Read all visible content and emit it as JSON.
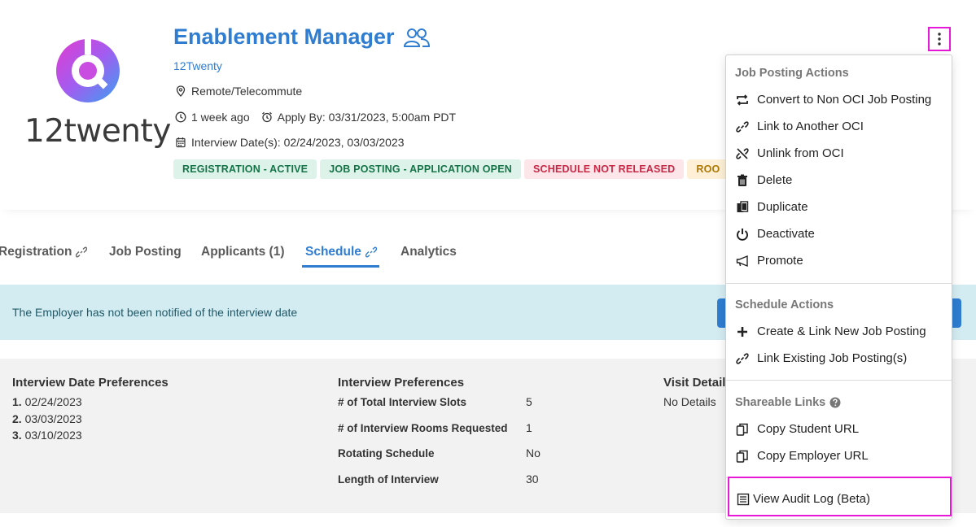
{
  "header": {
    "logo_text": "12twenty",
    "title": "Enablement Manager",
    "company": "12Twenty",
    "location": "Remote/Telecommute",
    "posted": "1 week ago",
    "apply_by": "Apply By: 03/31/2023, 5:00am PDT",
    "interview_dates": "Interview Date(s): 02/24/2023, 03/03/2023",
    "badges": [
      {
        "label": "REGISTRATION - ACTIVE",
        "tone": "green"
      },
      {
        "label": "JOB POSTING - APPLICATION OPEN",
        "tone": "green"
      },
      {
        "label": "SCHEDULE NOT RELEASED",
        "tone": "red"
      },
      {
        "label": "ROO",
        "tone": "yellow"
      }
    ]
  },
  "tabs": [
    {
      "label": "Registration",
      "linked": true,
      "active": false
    },
    {
      "label": "Job Posting",
      "linked": false,
      "active": false
    },
    {
      "label": "Applicants (1)",
      "linked": false,
      "active": false
    },
    {
      "label": "Schedule",
      "linked": true,
      "active": true
    },
    {
      "label": "Analytics",
      "linked": false,
      "active": false
    }
  ],
  "alert": {
    "text": "The Employer has not been notified of the interview date"
  },
  "details": {
    "date_prefs_title": "Interview Date Preferences",
    "date_prefs": [
      {
        "num": "1.",
        "date": "02/24/2023"
      },
      {
        "num": "2.",
        "date": "03/03/2023"
      },
      {
        "num": "3.",
        "date": "03/10/2023"
      }
    ],
    "interview_prefs_title": "Interview Preferences",
    "interview_prefs": [
      {
        "label": "# of Total Interview Slots",
        "value": "5"
      },
      {
        "label": "# of Interview Rooms Requested",
        "value": "1"
      },
      {
        "label": "Rotating Schedule",
        "value": "No"
      },
      {
        "label": "Length of Interview",
        "value": "30"
      }
    ],
    "visit_title": "Visit Detail",
    "visit_value": "No Details"
  },
  "menu": {
    "job_posting_actions": "Job Posting Actions",
    "job_items": [
      {
        "label": "Convert to Non OCI Job Posting",
        "icon": "convert-icon"
      },
      {
        "label": "Link to Another OCI",
        "icon": "link-icon"
      },
      {
        "label": "Unlink from OCI",
        "icon": "unlink-icon"
      },
      {
        "label": "Delete",
        "icon": "trash-icon"
      },
      {
        "label": "Duplicate",
        "icon": "duplicate-icon"
      },
      {
        "label": "Deactivate",
        "icon": "power-icon"
      },
      {
        "label": "Promote",
        "icon": "megaphone-icon"
      }
    ],
    "schedule_actions": "Schedule Actions",
    "schedule_items": [
      {
        "label": "Create & Link New Job Posting",
        "icon": "plus-icon"
      },
      {
        "label": "Link Existing Job Posting(s)",
        "icon": "link-icon"
      }
    ],
    "shareable_links": "Shareable Links",
    "share_items": [
      {
        "label": "Copy Student URL",
        "icon": "copy-icon"
      },
      {
        "label": "Copy Employer URL",
        "icon": "copy-icon"
      }
    ],
    "audit_label": "View Audit Log (Beta)"
  },
  "colors": {
    "accent": "#2f7dd1",
    "highlight": "#e619d6",
    "alert_bg": "#d3ecf2",
    "detail_bg": "#f2f2f2"
  }
}
